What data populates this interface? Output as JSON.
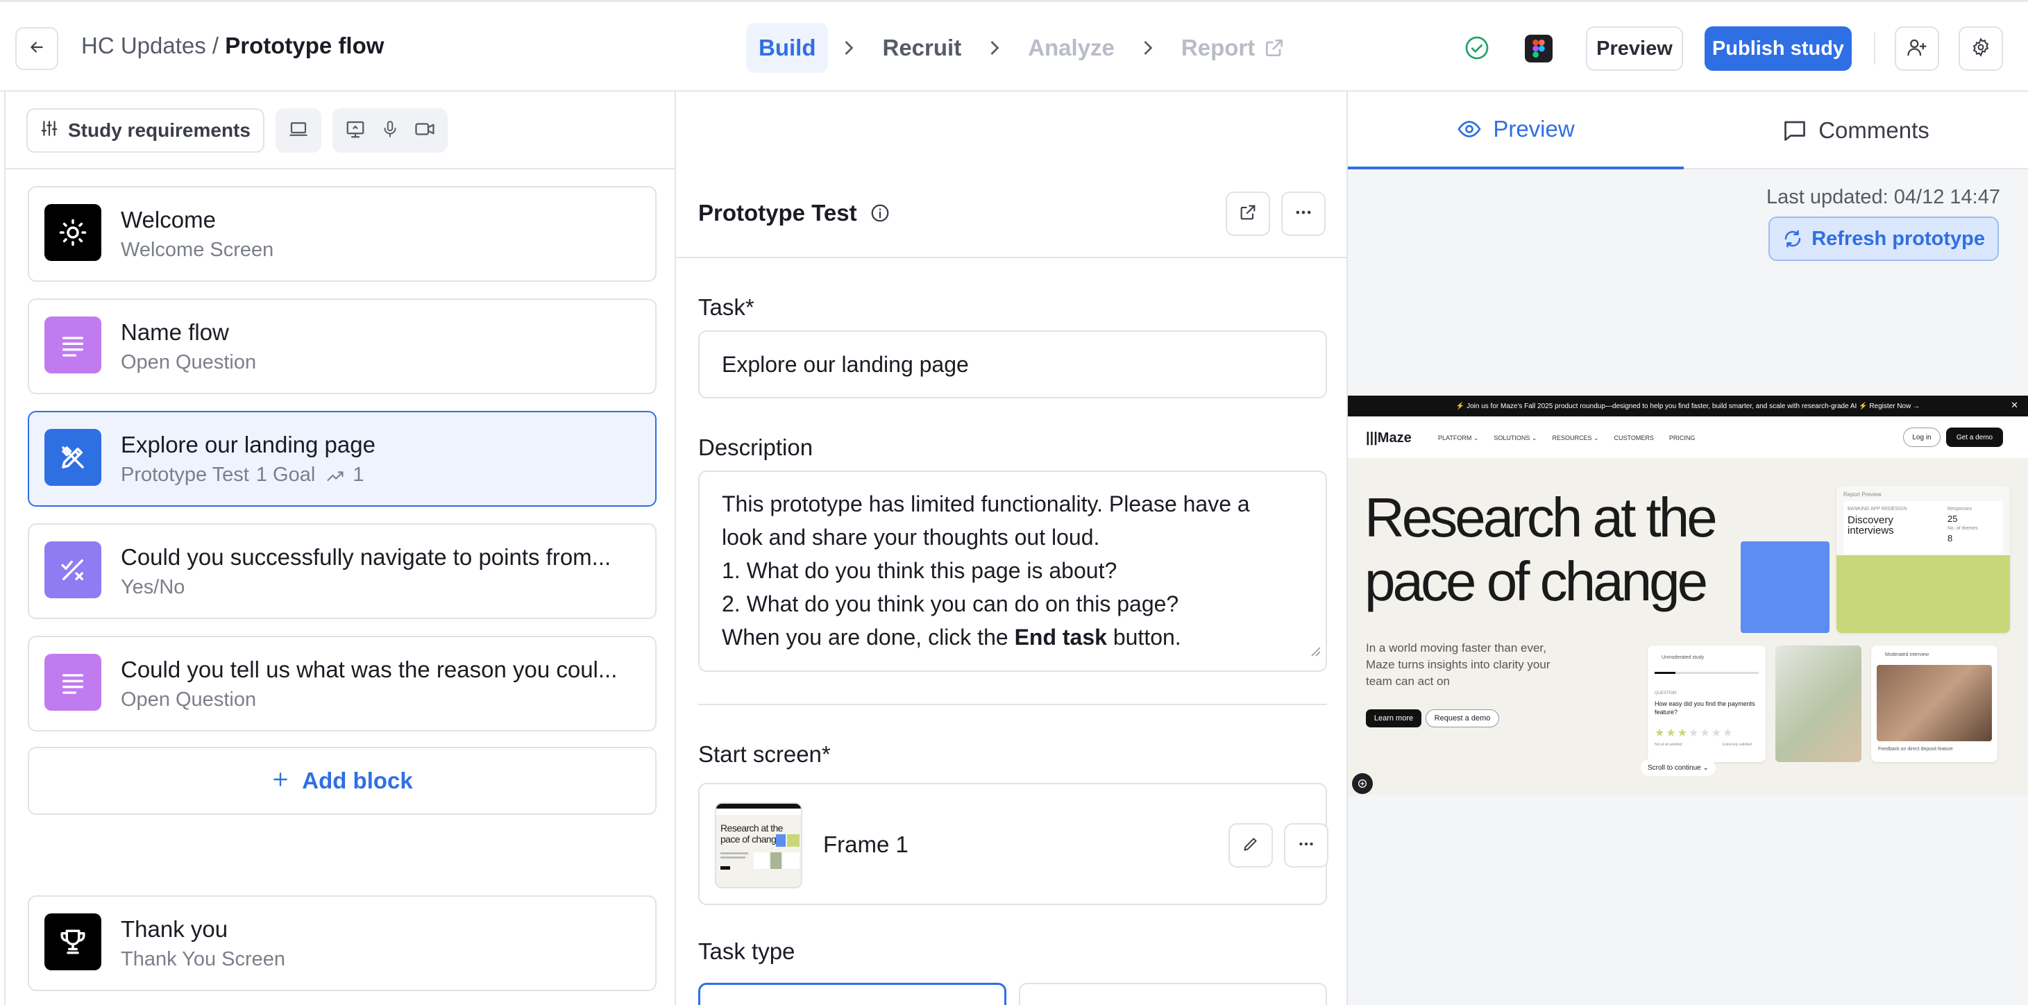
{
  "header": {
    "breadcrumb_parent": "HC Updates /",
    "breadcrumb_current": "Prototype flow",
    "steps": [
      {
        "label": "Build"
      },
      {
        "label": "Recruit"
      },
      {
        "label": "Analyze"
      },
      {
        "label": "Report"
      }
    ],
    "preview_label": "Preview",
    "publish_label": "Publish study",
    "colors": {
      "accent": "#2f6fe4",
      "accent_bg": "#eef3fe",
      "status_ok": "#22a36a"
    }
  },
  "requirements": {
    "label": "Study requirements",
    "device_icon": "laptop-icon",
    "chip_icons": [
      "screen-share-icon",
      "microphone-icon",
      "camera-icon"
    ]
  },
  "blocks": [
    {
      "title": "Welcome",
      "subtitle": "Welcome Screen",
      "icon": "sun-icon",
      "icon_bg": "#000000"
    },
    {
      "title": "Name flow",
      "subtitle": "Open Question",
      "icon": "text-lines-icon",
      "icon_bg": "#c07bf0"
    },
    {
      "title": "Explore our landing page",
      "subtitle": "Prototype Test",
      "goal": "1 Goal",
      "paths": "1",
      "icon": "prototype-icon",
      "icon_bg": "#2f6fe4"
    },
    {
      "title": "Could you successfully navigate to points from...",
      "subtitle": "Yes/No",
      "icon": "yes-no-icon",
      "icon_bg": "#8f7cf2"
    },
    {
      "title": "Could you tell us what was the reason you coul...",
      "subtitle": "Open Question",
      "icon": "text-lines-icon",
      "icon_bg": "#c07bf0"
    }
  ],
  "add_block_label": "Add block",
  "thank_you": {
    "title": "Thank you",
    "subtitle": "Thank You Screen",
    "icon": "trophy-icon"
  },
  "editor": {
    "title": "Prototype Test",
    "task_label": "Task*",
    "task_value": "Explore our landing page",
    "description_label": "Description",
    "description_lines": [
      "This prototype has limited functionality. Please have a",
      "look and share your thoughts out loud.",
      "1. What do you think this page is about?",
      "2. What do you think you can do on this page?"
    ],
    "description_last_pre": "When you are done, click the",
    "description_last_bold": "End task",
    "description_last_post": "button.",
    "start_screen_label": "Start screen*",
    "frame_name": "Frame 1",
    "task_type_label": "Task type"
  },
  "preview_panel": {
    "tab_preview": "Preview",
    "tab_comments": "Comments",
    "last_updated": "Last updated: 04/12 14:47",
    "refresh_label": "Refresh prototype",
    "site": {
      "banner": "⚡ Join us for Maze's Fall 2025 product roundup—designed to help you find faster, build smarter, and scale with research-grade AI ⚡   Register Now →",
      "logo": "Maze",
      "nav": [
        "PLATFORM ⌄",
        "SOLUTIONS ⌄",
        "RESOURCES ⌄",
        "CUSTOMERS",
        "PRICING"
      ],
      "login": "Log in",
      "demo": "Get a demo",
      "hero_line1": "Research at the",
      "hero_line2": "pace of change",
      "paragraph": "In a world moving faster than ever, Maze turns insights into clarity your team can act on",
      "learn_more": "Learn more",
      "request_demo": "Request a demo",
      "report_preview": "Report Preview",
      "report_kicker": "BANKING APP REDESIGN",
      "report_title": "Discovery interviews",
      "responses_label": "Responses",
      "responses_value": "25",
      "themes_label": "No. of themes",
      "themes_value": "8",
      "unmoderated": "Unmoderated study",
      "question_kicker": "QUESTION",
      "question": "How easy did you find the payments feature?",
      "scale_low": "Not at all satisfied",
      "scale_high": "Extremely satisfied",
      "moderated": "Moderated interview",
      "feedback": "Feedback on direct deposit feature",
      "scroll": "Scroll to continue ⌄"
    }
  }
}
